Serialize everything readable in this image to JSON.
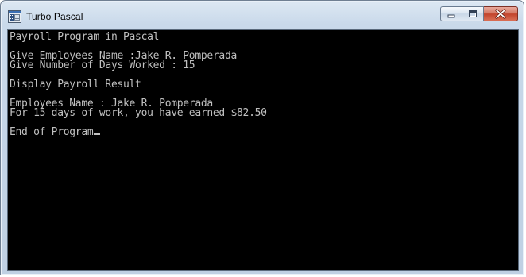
{
  "window": {
    "title": "Turbo Pascal",
    "icon": "turbo-pascal-app-icon",
    "buttons": {
      "minimize": "minimize-icon",
      "maximize": "maximize-icon",
      "close": "close-icon"
    },
    "colors": {
      "close_button": "#c2432b",
      "console_background": "#000000",
      "console_text": "#c0c0c0"
    }
  },
  "console": {
    "lines": [
      "Payroll Program in Pascal",
      "",
      "Give Employees Name :Jake R. Pomperada",
      "Give Number of Days Worked : 15",
      "",
      "Display Payroll Result",
      "",
      "Employees Name : Jake R. Pomperada",
      "For 15 days of work, you have earned $82.50",
      "",
      "End of Program"
    ]
  }
}
